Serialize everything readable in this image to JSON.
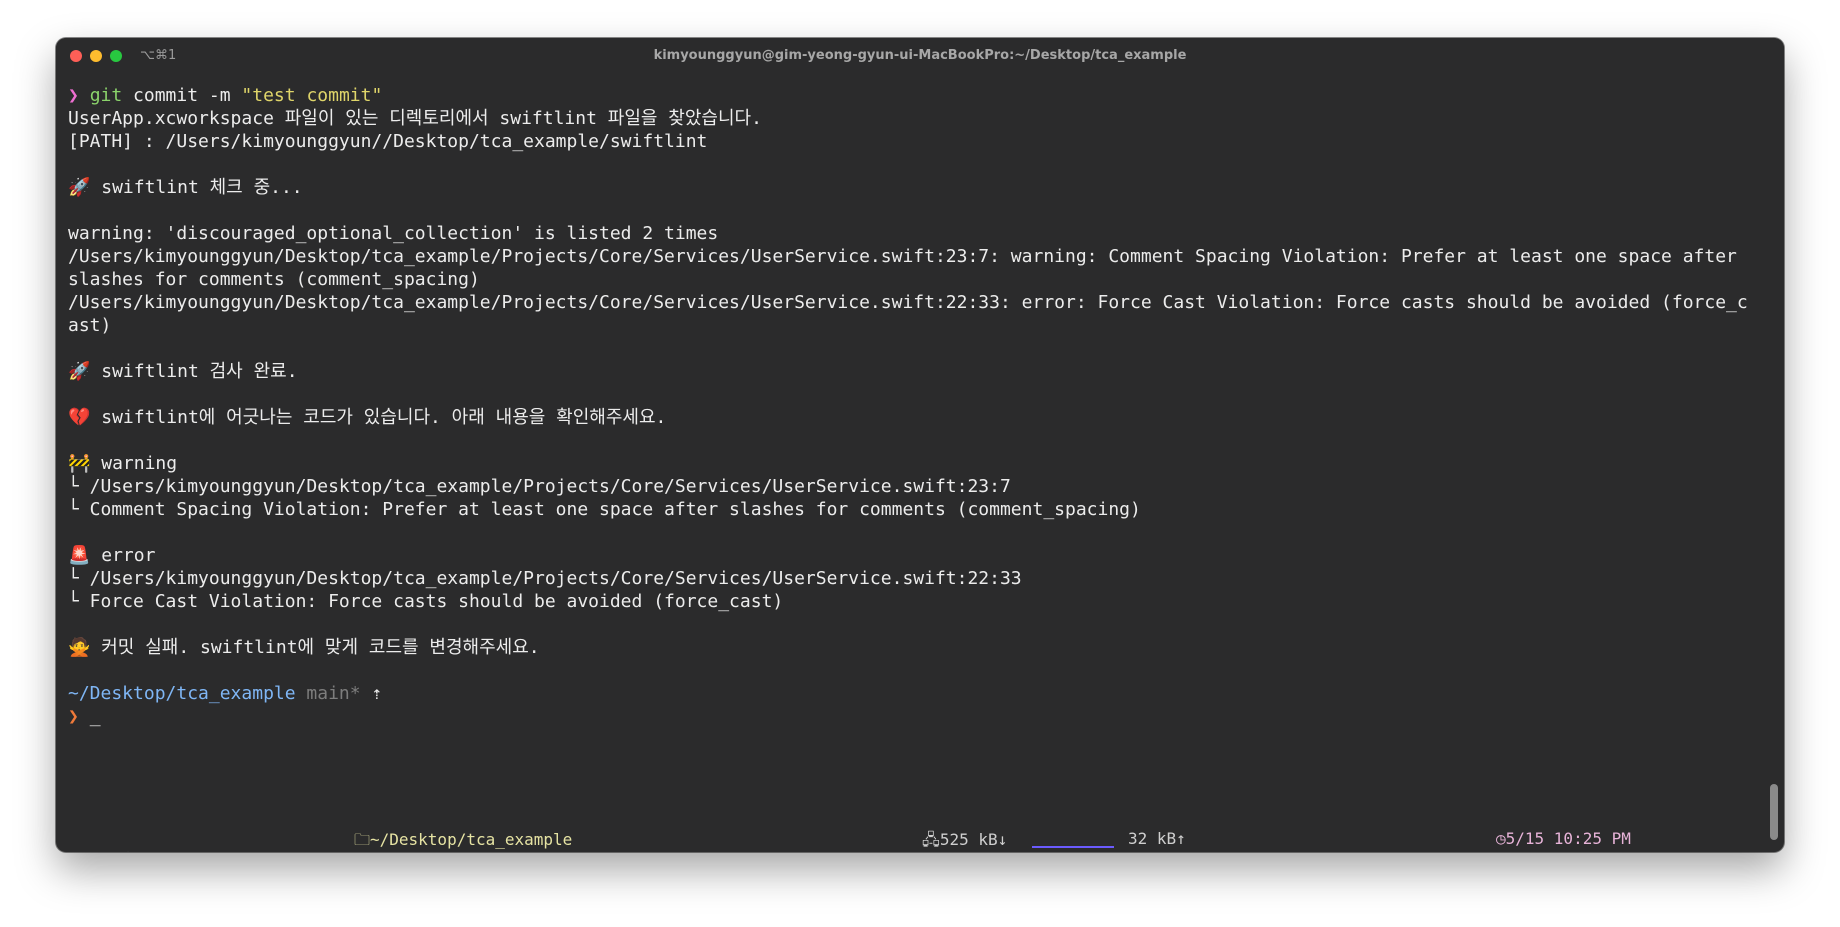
{
  "window": {
    "title": "kimyounggyun@gim-yeong-gyun-ui-MacBookPro:~/Desktop/tca_example",
    "tab_hint": "⌥⌘1"
  },
  "terminal": {
    "command": {
      "prompt": "❯",
      "git": "git",
      "rest": " commit -m ",
      "arg": "\"test commit\""
    },
    "lines": {
      "found": "UserApp.xcworkspace 파일이 있는 디렉토리에서 swiftlint 파일을 찾았습니다.",
      "path": "[PATH] : /Users/kimyounggyun//Desktop/tca_example/swiftlint",
      "checking": "🚀 swiftlint 체크 중...",
      "warn_dup": "warning: 'discouraged_optional_collection' is listed 2 times",
      "warn_full": "/Users/kimyounggyun/Desktop/tca_example/Projects/Core/Services/UserService.swift:23:7: warning: Comment Spacing Violation: Prefer at least one space after slashes for comments (comment_spacing)",
      "err_full": "/Users/kimyounggyun/Desktop/tca_example/Projects/Core/Services/UserService.swift:22:33: error: Force Cast Violation: Force casts should be avoided (force_cast)",
      "done": "🚀 swiftlint 검사 완료.",
      "broken": "💔 swiftlint에 어긋나는 코드가 있습니다. 아래 내용을 확인해주세요.",
      "warning_head": "🚧 warning",
      "warning_path": "└ /Users/kimyounggyun/Desktop/tca_example/Projects/Core/Services/UserService.swift:23:7",
      "warning_msg": "└ Comment Spacing Violation: Prefer at least one space after slashes for comments (comment_spacing)",
      "error_head": "🚨 error",
      "error_path": "└ /Users/kimyounggyun/Desktop/tca_example/Projects/Core/Services/UserService.swift:22:33",
      "error_msg": "└ Force Cast Violation: Force casts should be avoided (force_cast)",
      "fail": "🙅 커밋 실패. swiftlint에 맞게 코드를 변경해주세요."
    },
    "prompt2": {
      "cwd": "~/Desktop/tca_example",
      "branch": "main*",
      "up": "⇡",
      "arrow": "❯",
      "cursor": "_"
    }
  },
  "statusbar": {
    "user_icon": "user-icon",
    "dir": "🗀~/Desktop/tca_example",
    "down": "🖧525 kB↓",
    "up": "32 kB↑",
    "clock": "◷5/15 10:25 PM"
  }
}
